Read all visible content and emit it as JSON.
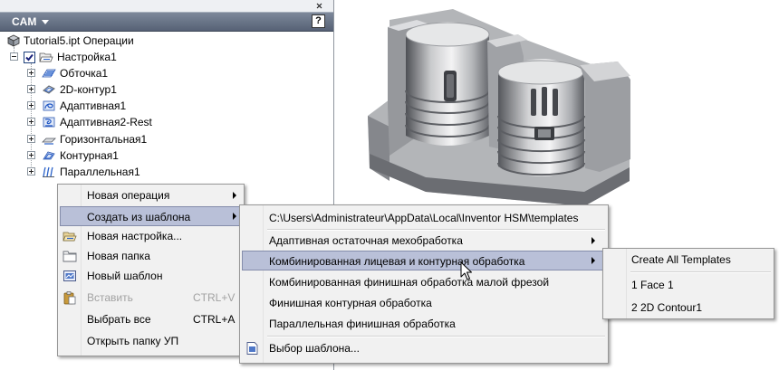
{
  "panel": {
    "title": "CAM",
    "help_glyph": "?",
    "icons": {
      "close": "close-icon",
      "title_menu": "chevron-down-icon",
      "help": "help-icon"
    }
  },
  "tree": {
    "root": {
      "label": "Tutorial5.ipt Операции",
      "icon": "part-document-icon"
    },
    "setup": {
      "label": "Настройка1",
      "expanded": true,
      "checked": true,
      "icon": "setup-icon"
    },
    "operations": [
      {
        "label": "Обточка1",
        "expanded": false,
        "icon": "facing-operation-icon"
      },
      {
        "label": "2D-контур1",
        "expanded": false,
        "icon": "contour-2d-operation-icon"
      },
      {
        "label": "Адаптивная1",
        "expanded": false,
        "icon": "adaptive-operation-icon"
      },
      {
        "label": "Адаптивная2-Rest",
        "expanded": false,
        "icon": "adaptive-rest-operation-icon"
      },
      {
        "label": "Горизонтальная1",
        "expanded": false,
        "icon": "horizontal-operation-icon"
      },
      {
        "label": "Контурная1",
        "expanded": false,
        "icon": "contour-operation-icon"
      },
      {
        "label": "Параллельная1",
        "expanded": false,
        "icon": "parallel-operation-icon"
      }
    ]
  },
  "context_menu": {
    "items": [
      {
        "label": "Новая операция",
        "has_submenu": true
      },
      {
        "label": "Создать из шаблона",
        "has_submenu": true,
        "highlighted": true
      },
      {
        "label": "Новая настройка...",
        "icon": "new-setup-icon"
      },
      {
        "label": "Новая папка",
        "icon": "new-folder-icon"
      },
      {
        "label": "Новый шаблон",
        "icon": "new-template-icon"
      },
      {
        "label": "Вставить",
        "shortcut": "CTRL+V",
        "disabled": true,
        "icon": "paste-icon"
      },
      {
        "label": "Выбрать все",
        "shortcut": "CTRL+A"
      },
      {
        "label": "Открыть папку УП"
      }
    ]
  },
  "template_submenu": {
    "path": "C:\\Users\\Administrateur\\AppData\\Local\\Inventor HSM\\templates",
    "items": [
      {
        "label": "Адаптивная остаточная мехобработка",
        "has_submenu": true
      },
      {
        "label": "Комбинированная лицевая и контурная обработка",
        "has_submenu": true,
        "highlighted": true
      },
      {
        "label": "Комбинированная финишная обработка малой фрезой"
      },
      {
        "label": "Финишная контурная обработка"
      },
      {
        "label": "Параллельная финишная обработка"
      }
    ],
    "browse": {
      "label": "Выбор шаблона...",
      "icon": "browse-template-icon"
    }
  },
  "template_items_submenu": {
    "items": [
      {
        "label": "Create All Templates"
      },
      {
        "label": "1 Face 1"
      },
      {
        "label": "2 2D Contour1"
      }
    ]
  },
  "colors": {
    "title_bar": "#5d697d",
    "menu_background": "#f1f1f1",
    "menu_highlight": "#b9c0d8",
    "menu_highlight_border": "#858dab",
    "disabled_text": "#a2a2a2",
    "tree_icon_blue": "#2a62c9"
  }
}
